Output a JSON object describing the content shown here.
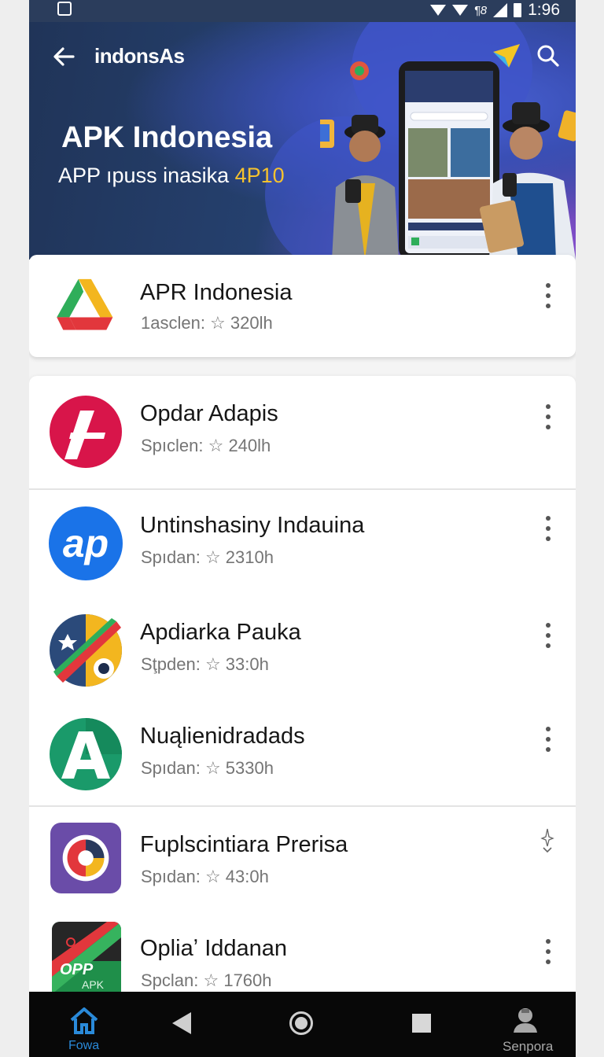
{
  "status_bar": {
    "time": "1:96",
    "net": "¶8"
  },
  "header": {
    "brand": "indonsAs"
  },
  "banner": {
    "title": "APK Indonesia",
    "subtitle_prefix": "APP ıpuss inasika ",
    "subtitle_highlight": "4P10"
  },
  "featured": {
    "name": "APR Indonesia",
    "meta": "1asclеn: ☆ 320lh"
  },
  "apps": [
    {
      "name": "Opdar Adapis",
      "meta": "Spıclen: ☆ 240lh"
    },
    {
      "name": "Untinshasiny Indauina",
      "meta": "Spıdan: ☆ 2310h"
    },
    {
      "name": "Apdiarka Pauka",
      "meta": "Sţpden: ☆ 33:0h"
    },
    {
      "name": "Nuąlienidradads",
      "meta": "Spıdan: ☆ 5330h"
    },
    {
      "name": "Fuplscintiara Prerisa",
      "meta": "Spıdan: ☆ 43:0h"
    },
    {
      "name": "Opliaʼ Iddanan",
      "meta": "Spclan: ☆ 1760h"
    }
  ],
  "app_icon_text": {
    "ap": "ap",
    "opp": "OPP",
    "apk": "APK"
  },
  "nav": {
    "home_label": "Fowa",
    "user_label": "Senpora"
  },
  "colors": {
    "accent": "#2a8ad9",
    "banner": "#25406e",
    "highlight": "#f5c22e"
  }
}
